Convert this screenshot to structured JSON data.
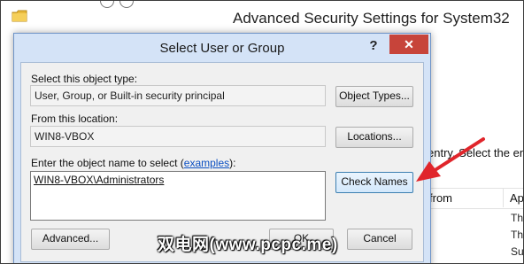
{
  "background_window": {
    "title": "Advanced Security Settings for System32",
    "partial_text_entry": "entry. Select the entry",
    "table_columns": [
      "from",
      "Ap"
    ],
    "cells": [
      "Th",
      "Th",
      "Su"
    ]
  },
  "dialog": {
    "title": "Select User or Group",
    "help_label": "?",
    "close_label": "✕",
    "object_type_label": "Select this object type:",
    "object_type_value": "User, Group, or Built-in security principal",
    "object_types_button": "Object Types...",
    "location_label": "From this location:",
    "location_value": "WIN8-VBOX",
    "locations_button": "Locations...",
    "enter_label_prefix": "Enter the object name to select (",
    "enter_label_link": "examples",
    "enter_label_suffix": "):",
    "object_name_value": "WIN8-VBOX\\Administrators",
    "check_names_button": "Check Names",
    "advanced_button": "Advanced...",
    "ok_button": "OK",
    "cancel_button": "Cancel"
  },
  "watermark": "双电网(www.pcpc.me)",
  "colors": {
    "close_button": "#c7443a",
    "dialog_frame": "#d4e3f7",
    "annotation_arrow": "#e0252b",
    "link": "#0b4fc2"
  }
}
